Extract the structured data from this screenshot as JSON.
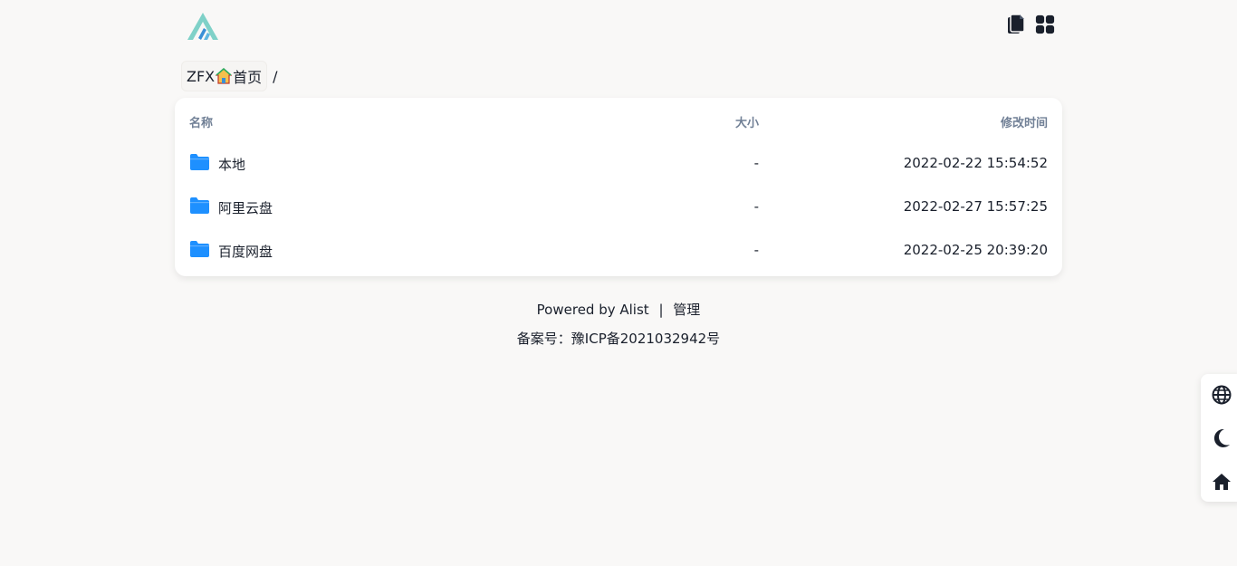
{
  "header": {
    "logo_icon": "alist-logo-icon",
    "actions": [
      {
        "icon": "copy-icon"
      },
      {
        "icon": "grid-view-icon"
      }
    ]
  },
  "breadcrumb": {
    "items": [
      {
        "label_prefix": "ZFX",
        "icon": "house-icon",
        "label_suffix": "首页"
      }
    ],
    "separator": "/"
  },
  "file_list": {
    "columns": {
      "name": "名称",
      "size": "大小",
      "modified": "修改时间"
    },
    "rows": [
      {
        "icon": "folder-icon",
        "name": "本地",
        "size": "-",
        "modified": "2022-02-22 15:54:52"
      },
      {
        "icon": "folder-icon",
        "name": "阿里云盘",
        "size": "-",
        "modified": "2022-02-27 15:57:25"
      },
      {
        "icon": "folder-icon",
        "name": "百度网盘",
        "size": "-",
        "modified": "2022-02-25 20:39:20"
      }
    ]
  },
  "footer": {
    "powered_by": "Powered by Alist",
    "divider": "|",
    "manage_link": "管理",
    "icp": "备案号：豫ICP备2021032942号"
  },
  "side_panel": {
    "buttons": [
      {
        "icon": "globe-icon"
      },
      {
        "icon": "moon-icon"
      },
      {
        "icon": "home-icon"
      }
    ]
  },
  "colors": {
    "background": "#f9f8f7",
    "folder": "#1e90ff",
    "header_text": "#718096",
    "logo_light": "#7fd1c8",
    "logo_dark": "#3a8fd6"
  }
}
